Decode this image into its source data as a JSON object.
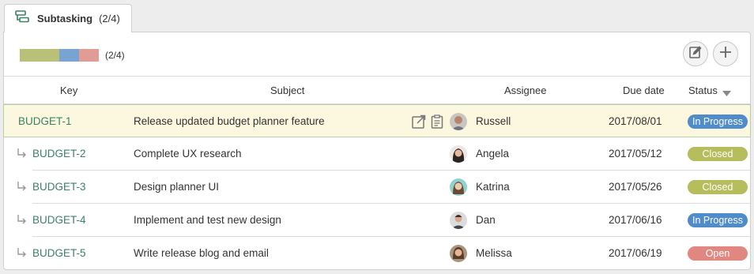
{
  "tab": {
    "title": "Subtasking",
    "count": "(2/4)",
    "icon": "subtask-icon"
  },
  "progress": {
    "label": "(2/4)",
    "segments": [
      {
        "name": "closed",
        "fraction": 0.5,
        "color": "#b9c178"
      },
      {
        "name": "in-progress",
        "fraction": 0.25,
        "color": "#79a3d1"
      },
      {
        "name": "open",
        "fraction": 0.25,
        "color": "#e29c96"
      }
    ]
  },
  "toolbar": {
    "edit_icon": "edit-icon",
    "add_icon": "plus-icon"
  },
  "columns": {
    "key": "Key",
    "subject": "Subject",
    "assignee": "Assignee",
    "due": "Due date",
    "status": "Status"
  },
  "colors": {
    "in_progress": "#4f8cc9",
    "closed": "#b5bd5c",
    "open": "#e0887f",
    "key_link": "#3b8266"
  },
  "rows": [
    {
      "key": "BUDGET-1",
      "subject": "Release updated budget planner feature",
      "assignee": "Russell",
      "due": "2017/08/01",
      "status": "In Progress"
    },
    {
      "key": "BUDGET-2",
      "subject": "Complete UX research",
      "assignee": "Angela",
      "due": "2017/05/12",
      "status": "Closed"
    },
    {
      "key": "BUDGET-3",
      "subject": "Design planner UI",
      "assignee": "Katrina",
      "due": "2017/05/26",
      "status": "Closed"
    },
    {
      "key": "BUDGET-4",
      "subject": "Implement and test new design",
      "assignee": "Dan",
      "due": "2017/06/16",
      "status": "In Progress"
    },
    {
      "key": "BUDGET-5",
      "subject": "Write release blog and email",
      "assignee": "Melissa",
      "due": "2017/06/19",
      "status": "Open"
    }
  ]
}
